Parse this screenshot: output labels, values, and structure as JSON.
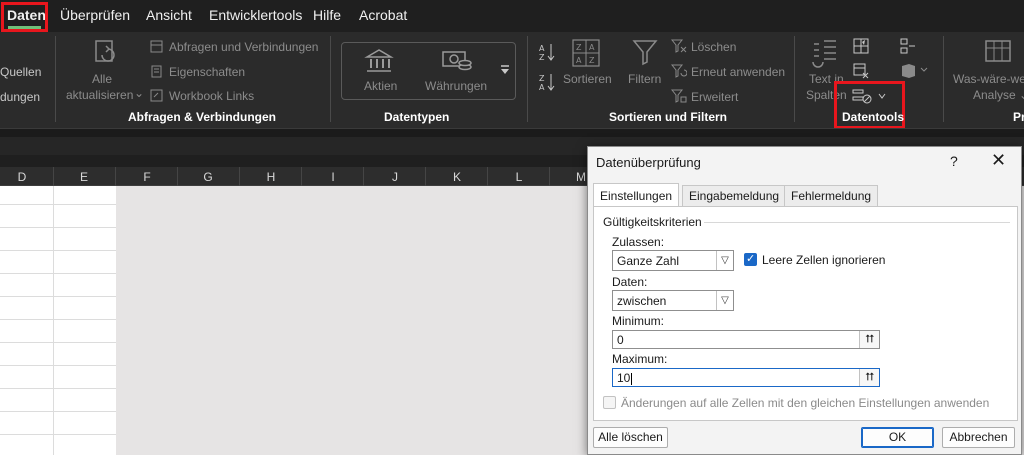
{
  "menu": {
    "tabs": [
      "Daten",
      "Überprüfen",
      "Ansicht",
      "Entwicklertools",
      "Hilfe",
      "Acrobat"
    ],
    "active_tab": "Daten"
  },
  "ribbon": {
    "left_cut_labels": [
      "Quellen",
      "dungen"
    ],
    "refresh_all": [
      "Alle",
      "aktualisieren"
    ],
    "refresh_all_arrow": "⌄",
    "queries_connections": "Abfragen und Verbindungen",
    "properties": "Eigenschaften",
    "workbook_links": "Workbook Links",
    "group_queries": "Abfragen & Verbindungen",
    "stocks": "Aktien",
    "currencies": "Währungen",
    "group_datatypes": "Datentypen",
    "sort": "Sortieren",
    "filter": "Filtern",
    "clear": "Löschen",
    "reapply": "Erneut anwenden",
    "advanced": "Erweitert",
    "group_sort_filter": "Sortieren und Filtern",
    "text_to_columns": [
      "Text in",
      "Spalten"
    ],
    "group_datatools": "Datentools",
    "what_if": [
      "Was-wäre-we",
      "Analyse ⌄"
    ],
    "cut_group": "Pr"
  },
  "sheet": {
    "columns": [
      "D",
      "E",
      "F",
      "G",
      "H",
      "I",
      "J",
      "K",
      "L",
      "M"
    ]
  },
  "dialog": {
    "title": "Datenüberprüfung",
    "help": "?",
    "close": "✕",
    "tabs": [
      "Einstellungen",
      "Eingabemeldung",
      "Fehlermeldung"
    ],
    "active_tab": "Einstellungen",
    "group_title": "Gültigkeitskriterien",
    "allow_label": "Zulassen:",
    "allow_value": "Ganze Zahl",
    "ignore_blank_label": "Leere Zellen ignorieren",
    "ignore_blank_checked": true,
    "data_label": "Daten:",
    "data_value": "zwischen",
    "minimum_label": "Minimum:",
    "minimum_value": "0",
    "maximum_label": "Maximum:",
    "maximum_value": "10",
    "apply_all_label": "Änderungen auf alle Zellen mit den gleichen Einstellungen anwenden",
    "apply_all_checked": false,
    "clear_all_button": "Alle löschen",
    "ok_button": "OK",
    "cancel_button": "Abbrechen"
  },
  "colors": {
    "highlight_red": "#e8161d",
    "active_tab_underline": "#6fc17a",
    "checkbox_blue": "#1a68c7"
  }
}
